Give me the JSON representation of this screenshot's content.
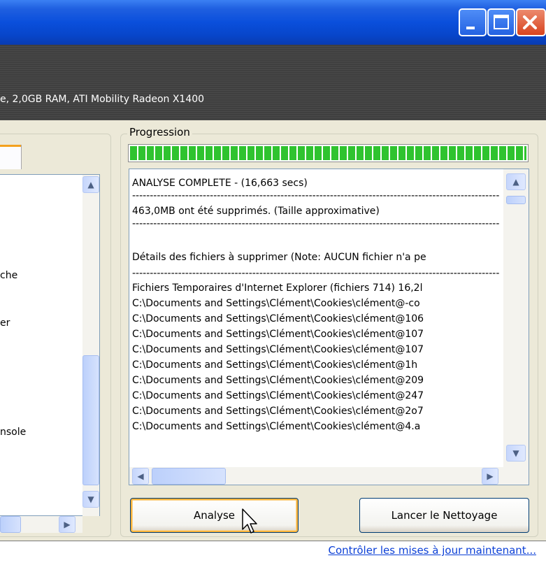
{
  "window": {
    "controls": [
      "minimize-icon",
      "maximize-icon",
      "close-icon"
    ],
    "system_info": "e, 2,0GB RAM, ATI Mobility Radeon X1400"
  },
  "left_panel": {
    "visible_fragments": [
      "che",
      "er",
      "nsole"
    ]
  },
  "progression": {
    "legend": "Progression",
    "progress_fraction": 1.0,
    "progress_color": "#2fc32f"
  },
  "log": {
    "lines": [
      "ANALYSE COMPLETE - (16,663 secs)",
      "--------------------------------------------------------------------------------------------------------",
      "463,0MB ont été supprimés. (Taille approximative)",
      "--------------------------------------------------------------------------------------------------------",
      "",
      "Détails des fichiers à supprimer (Note: AUCUN fichier n'a pe",
      "--------------------------------------------------------------------------------------------------------",
      "Fichiers Temporaires d'Internet Explorer (fichiers 714) 16,2l",
      "C:\\Documents and Settings\\Clément\\Cookies\\clément@-co",
      "C:\\Documents and Settings\\Clément\\Cookies\\clément@106",
      "C:\\Documents and Settings\\Clément\\Cookies\\clément@107",
      "C:\\Documents and Settings\\Clément\\Cookies\\clément@107",
      "C:\\Documents and Settings\\Clément\\Cookies\\clément@1h",
      "C:\\Documents and Settings\\Clément\\Cookies\\clément@209",
      "C:\\Documents and Settings\\Clément\\Cookies\\clément@247",
      "C:\\Documents and Settings\\Clément\\Cookies\\clément@2o7",
      "C:\\Documents and Settings\\Clément\\Cookies\\clément@4.a"
    ]
  },
  "buttons": {
    "analyse": "Analyse",
    "clean": "Lancer le Nettoyage"
  },
  "footer": {
    "update_link": "Contrôler les mises à jour maintenant..."
  },
  "colors": {
    "titlebar": "#0a4fdc",
    "window_bg": "#ece9d8",
    "link": "#0b3fd6",
    "focus_ring": "#f8b33b"
  }
}
